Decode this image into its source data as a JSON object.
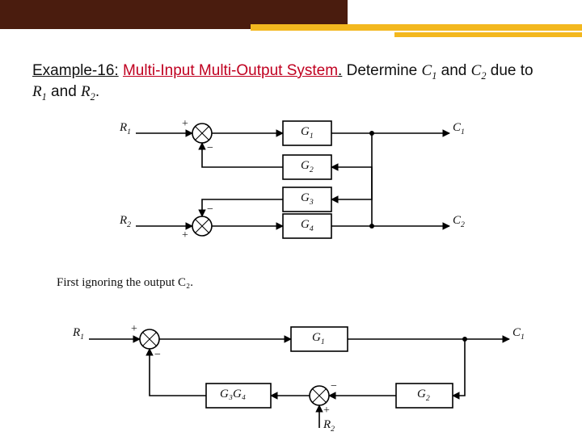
{
  "header": {
    "example_id": "Example-16:",
    "title_red": "Multi-Input Multi-Output System",
    "period": ".",
    "tail1": " Determine ",
    "tail2": " and ",
    "tail3": " due to ",
    "tail4": " and ",
    "tail5": "."
  },
  "vars": {
    "C1": "C",
    "C1s": "1",
    "C2": "C",
    "C2s": "2",
    "R1": "R",
    "R1s": "1",
    "R2": "R",
    "R2s": "2",
    "G1": "G",
    "G1s": "1",
    "G2": "G",
    "G2s": "2",
    "G3": "G",
    "G3s": "3",
    "G4": "G",
    "G4s": "4",
    "G3G4": "G₃G₄"
  },
  "signs": {
    "plus": "+",
    "minus": "−"
  },
  "note": {
    "first_ignore": "First ignoring the output C₂."
  },
  "chart_data": [
    {
      "type": "block-diagram",
      "name": "MIMO system",
      "inputs": [
        "R1",
        "R2"
      ],
      "outputs": [
        "C1",
        "C2"
      ],
      "summing_junctions": [
        {
          "id": "S1",
          "inputs": [
            {
              "from": "R1",
              "sign": "+"
            },
            {
              "from": "G2",
              "sign": "-"
            }
          ],
          "output_to": "G1"
        },
        {
          "id": "S2",
          "inputs": [
            {
              "from": "R2",
              "sign": "+"
            },
            {
              "from": "G3",
              "sign": "-"
            }
          ],
          "output_to": "G4"
        }
      ],
      "blocks": [
        {
          "id": "G1",
          "label": "G1",
          "in_from": "S1",
          "out_to": "C1"
        },
        {
          "id": "G2",
          "label": "G2",
          "in_from": "C2",
          "out_to": "S1"
        },
        {
          "id": "G3",
          "label": "G3",
          "in_from": "C1",
          "out_to": "S2"
        },
        {
          "id": "G4",
          "label": "G4",
          "in_from": "S2",
          "out_to": "C2"
        }
      ],
      "branches": [
        {
          "from": "G1_out",
          "to": [
            "C1",
            "G3"
          ]
        },
        {
          "from": "G4_out",
          "to": [
            "C2",
            "G2"
          ]
        }
      ]
    },
    {
      "type": "block-diagram",
      "name": "Reduced for C1 (ignoring C2)",
      "inputs": [
        "R1",
        "R2"
      ],
      "outputs": [
        "C1"
      ],
      "summing_junctions": [
        {
          "id": "SA",
          "inputs": [
            {
              "from": "R1",
              "sign": "+"
            },
            {
              "from": "G3G4_out",
              "sign": "-"
            }
          ],
          "output_to": "G1"
        },
        {
          "id": "SB",
          "inputs": [
            {
              "from": "G2_out",
              "sign": "-"
            },
            {
              "from": "R2",
              "sign": "+"
            }
          ],
          "output_to": "G3G4"
        }
      ],
      "blocks": [
        {
          "id": "G1",
          "label": "G1",
          "in_from": "SA",
          "out_to": "C1"
        },
        {
          "id": "G2",
          "label": "G2",
          "in_from": "C1",
          "out_to": "SB"
        },
        {
          "id": "G3G4",
          "label": "G3G4",
          "in_from": "SB",
          "out_to": "SA"
        }
      ]
    }
  ]
}
